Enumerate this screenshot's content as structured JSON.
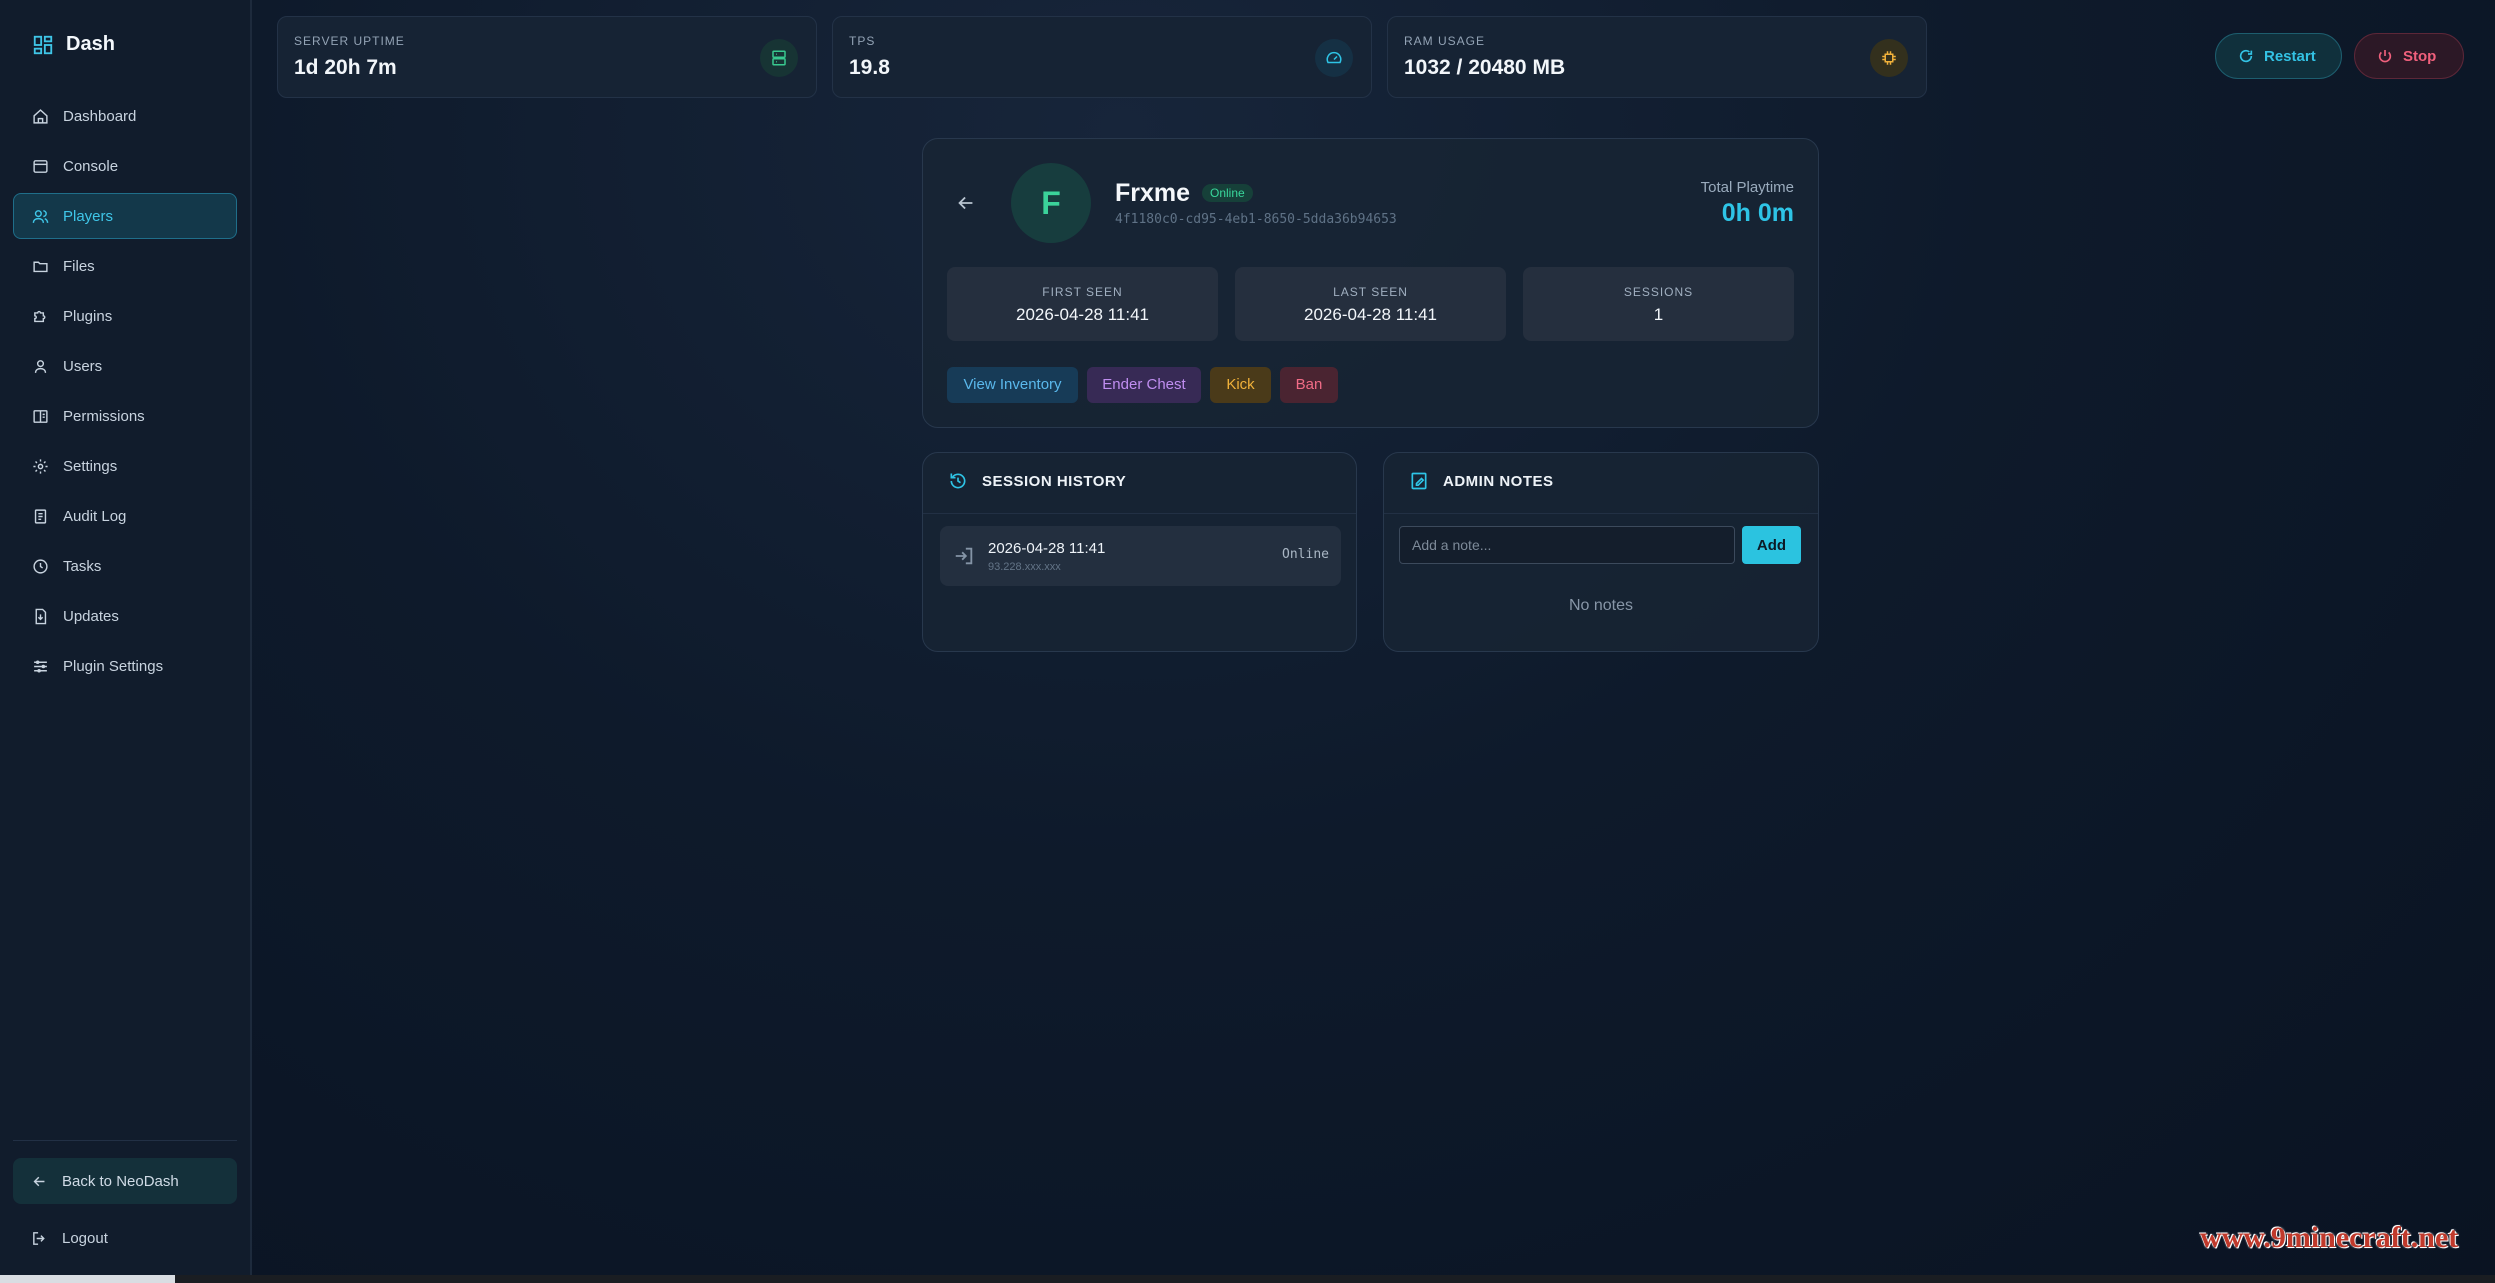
{
  "sidebar": {
    "brand": "Dash",
    "items": [
      {
        "label": "Dashboard",
        "icon": "home-icon"
      },
      {
        "label": "Console",
        "icon": "terminal-icon"
      },
      {
        "label": "Players",
        "icon": "users-icon",
        "active": true
      },
      {
        "label": "Files",
        "icon": "folder-icon"
      },
      {
        "label": "Plugins",
        "icon": "puzzle-icon"
      },
      {
        "label": "Users",
        "icon": "user-icon"
      },
      {
        "label": "Permissions",
        "icon": "book-icon"
      },
      {
        "label": "Settings",
        "icon": "gear-icon"
      },
      {
        "label": "Audit Log",
        "icon": "clipboard-icon"
      },
      {
        "label": "Tasks",
        "icon": "clock-icon"
      },
      {
        "label": "Updates",
        "icon": "file-download-icon"
      },
      {
        "label": "Plugin Settings",
        "icon": "sliders-icon"
      }
    ],
    "back_label": "Back to NeoDash",
    "logout_label": "Logout"
  },
  "stats": {
    "uptime": {
      "label": "SERVER UPTIME",
      "value": "1d 20h 7m"
    },
    "tps": {
      "label": "TPS",
      "value": "19.8"
    },
    "ram": {
      "label": "RAM USAGE",
      "value": "1032 / 20480 MB"
    }
  },
  "controls": {
    "restart": "Restart",
    "stop": "Stop"
  },
  "player": {
    "initial": "F",
    "name": "Frxme",
    "status": "Online",
    "uuid": "4f1180c0-cd95-4eb1-8650-5dda36b94653",
    "playtime_label": "Total Playtime",
    "playtime_value": "0h 0m",
    "first_seen_label": "FIRST SEEN",
    "first_seen": "2026-04-28 11:41",
    "last_seen_label": "LAST SEEN",
    "last_seen": "2026-04-28 11:41",
    "sessions_label": "SESSIONS",
    "sessions": "1",
    "actions": {
      "inventory": "View Inventory",
      "ender": "Ender Chest",
      "kick": "Kick",
      "ban": "Ban"
    }
  },
  "session_history": {
    "title": "SESSION HISTORY",
    "rows": [
      {
        "date": "2026-04-28 11:41",
        "ip": "93.228.xxx.xxx",
        "status": "Online"
      }
    ]
  },
  "admin_notes": {
    "title": "ADMIN NOTES",
    "placeholder": "Add a note...",
    "add_label": "Add",
    "empty_text": "No notes"
  },
  "watermark": "www.9minecraft.net",
  "colors": {
    "accent": "#2ec4e6",
    "online": "#39d79b",
    "kick": "#f0b13a",
    "ban": "#f06c86",
    "ender": "#c08ef0"
  }
}
